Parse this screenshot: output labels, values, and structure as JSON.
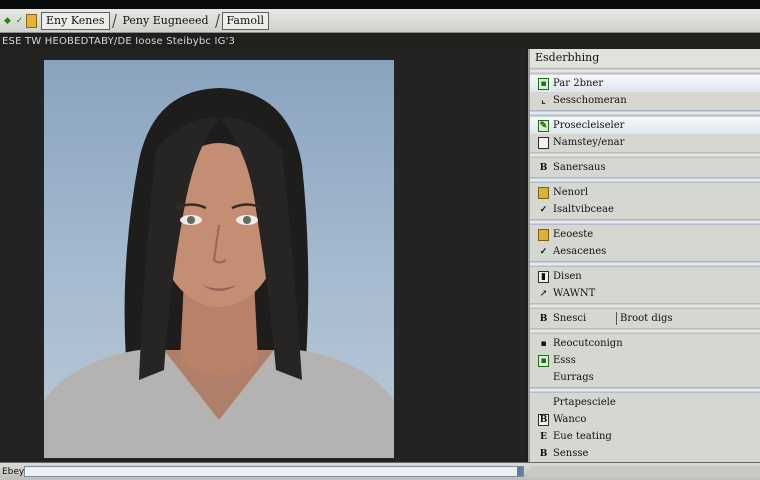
{
  "tabs": [
    {
      "label": "Eny Kenes"
    },
    {
      "label": "Peny Eugneeed"
    },
    {
      "label": "Famoll"
    }
  ],
  "infobar": {
    "text": "ESE TW HEOBEDTABY/DE  Ioose Steibybc IG'3"
  },
  "panel": {
    "title": "Esderbhing",
    "rows": [
      {
        "label": "Par 2bner",
        "icon": "layer-icon"
      },
      {
        "label": "Sesschomeran",
        "icon": "tool-icon"
      },
      {
        "label": "Prosecleiseler",
        "icon": "brush-icon"
      },
      {
        "label": "Namstey/enar",
        "icon": "layer-icon"
      },
      {
        "label": "Sanersaus",
        "icon": "layer-icon"
      },
      {
        "label": "Nenorl",
        "icon": "layer-icon"
      },
      {
        "label": "Isaltvibceae",
        "icon": "check-icon"
      },
      {
        "label": "Eeoeste",
        "icon": "layer-icon"
      },
      {
        "label": "Aesacenes",
        "icon": "check-icon"
      },
      {
        "label": "Disen",
        "icon": "folder-icon"
      },
      {
        "label": "WAWNT",
        "icon": "arrow-icon"
      },
      {
        "label": "Snesci",
        "extra": "Broot digs",
        "icon": "layer-icon"
      },
      {
        "label": "Reocutconign",
        "icon": "layer-icon"
      },
      {
        "label": "Esss",
        "icon": "layer-icon"
      },
      {
        "label": "Eurrags",
        "icon": "layer-icon"
      },
      {
        "label": "Prtapesciele",
        "icon": "layer-icon"
      },
      {
        "label": "Wanco",
        "icon": "layer-icon"
      },
      {
        "label": "Eue teating",
        "icon": "layer-icon"
      },
      {
        "label": "Sensse",
        "icon": "layer-icon"
      }
    ]
  },
  "statusbar": {
    "text": "Ebey"
  },
  "colors": {
    "accent": "#5c7ea3",
    "background": "#232323",
    "panel": "#d6d7d1"
  }
}
